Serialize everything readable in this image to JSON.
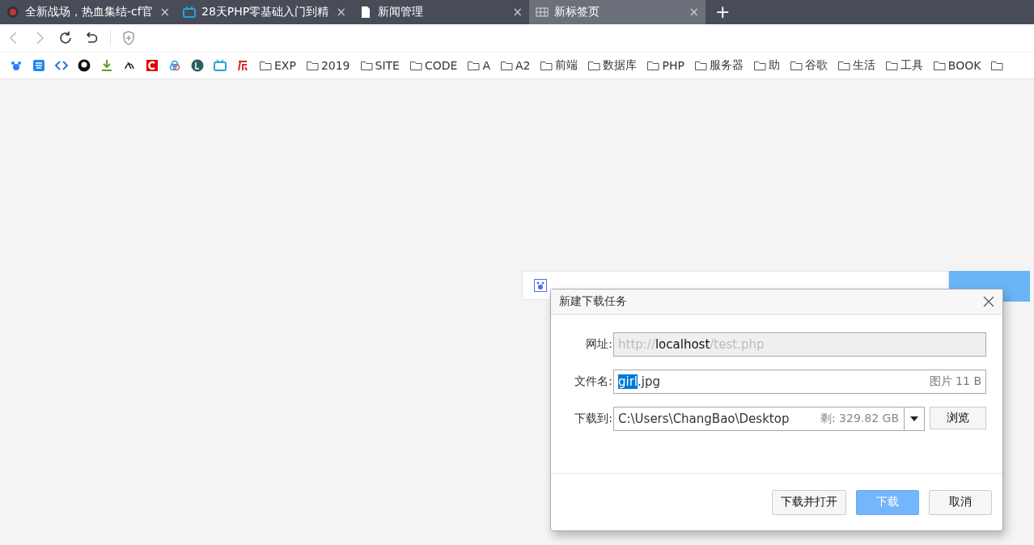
{
  "tabs": [
    {
      "title": "全新战场，热血集结-cf官",
      "selected": false,
      "close": "×"
    },
    {
      "title": "28天PHP零基础入门到精",
      "selected": false,
      "close": "×"
    },
    {
      "title": "新闻管理",
      "selected": false,
      "close": "×"
    },
    {
      "title": "新标签页",
      "selected": true,
      "close": "×"
    }
  ],
  "new_tab": "+",
  "bookmark_folders": [
    "EXP",
    "2019",
    "SITE",
    "CODE",
    "A",
    "A2",
    "前端",
    "数据库",
    "PHP",
    "服务器",
    "助",
    "谷歌",
    "生活",
    "工具",
    "BOOK"
  ],
  "dialog": {
    "title": "新建下载任务",
    "url_label": "网址:",
    "url": {
      "scheme": "http://",
      "host": "localhost",
      "path": "/test.php"
    },
    "name_label": "文件名:",
    "name": {
      "selected_text": "girl",
      "rest": ".jpg"
    },
    "file_info": "图片 11 B",
    "dir_label": "下载到:",
    "dir": "C:\\Users\\ChangBao\\Desktop",
    "free_space": "剩: 329.82 GB",
    "browse": "浏览",
    "buttons": [
      {
        "label": "下载并打开",
        "kind": "default"
      },
      {
        "label": "下载",
        "kind": "primary"
      },
      {
        "label": "取消",
        "kind": "default"
      }
    ]
  }
}
